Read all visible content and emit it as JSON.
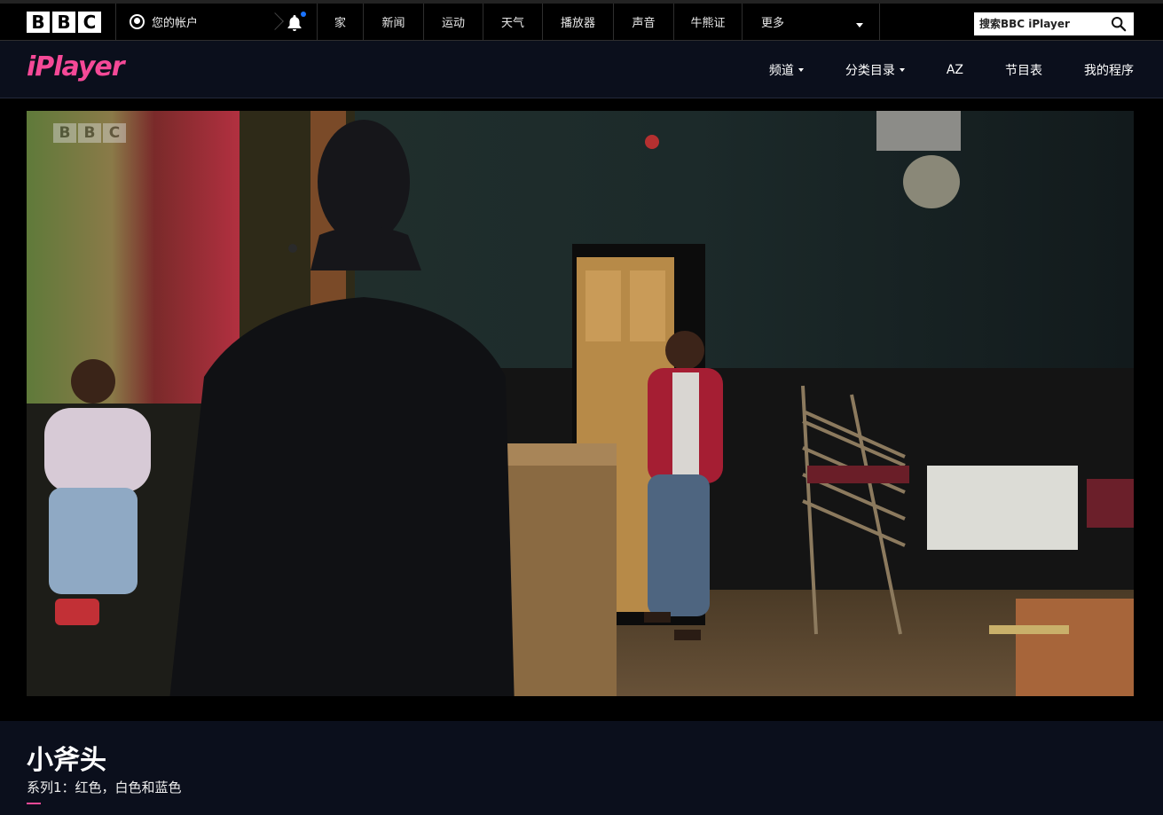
{
  "bbc_bar": {
    "logo_letters": [
      "B",
      "B",
      "C"
    ],
    "account_label": "您的帐户",
    "notification_icon": "bell-icon",
    "notification_indicator_color": "#1a73ff",
    "nav_items": [
      "家",
      "新闻",
      "运动",
      "天气",
      "播放器",
      "声音",
      "牛熊证",
      "更多"
    ],
    "search_placeholder": "搜索BBC iPlayer",
    "search_icon": "search-icon"
  },
  "iplayer_header": {
    "logo_text": "iPlayer",
    "brand_color": "#f54997",
    "nav": [
      {
        "label": "频道",
        "dropdown": true
      },
      {
        "label": "分类目录",
        "dropdown": true
      },
      {
        "label": "AZ",
        "dropdown": false
      },
      {
        "label": "节目表",
        "dropdown": false
      },
      {
        "label": "我的程序",
        "dropdown": false
      }
    ]
  },
  "player": {
    "watermark": [
      "B",
      "B",
      "C"
    ]
  },
  "programme": {
    "title": "小斧头",
    "subtitle": "系列1：红色，白色和蓝色"
  }
}
